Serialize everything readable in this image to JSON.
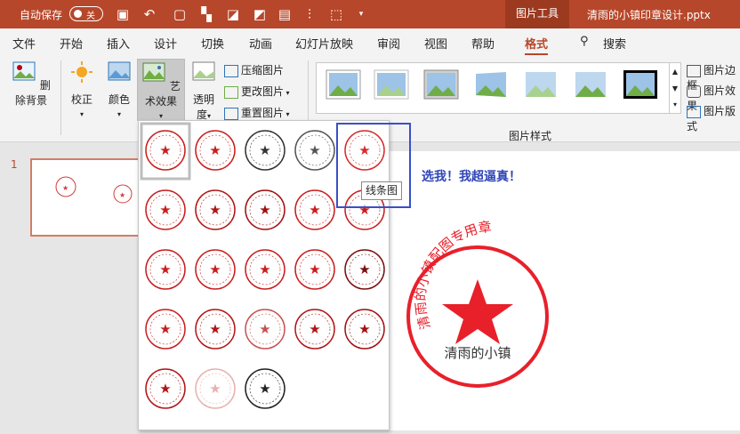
{
  "titlebar": {
    "autosave_label": "自动保存",
    "autosave_toggle": "关",
    "tool_tab": "图片工具",
    "filename": "清雨的小镇印章设计.pptx"
  },
  "menu": [
    "文件",
    "开始",
    "插入",
    "设计",
    "切换",
    "动画",
    "幻灯片放映",
    "审阅",
    "视图",
    "帮助",
    "格式"
  ],
  "search_label": "搜索",
  "ribbon": {
    "remove_bg": "删除背景",
    "correct": "校正",
    "color": "颜色",
    "artistic": "艺术效果",
    "transparency_1": "透明",
    "transparency_2": "度",
    "compress": "压缩图片",
    "change": "更改图片",
    "reset": "重置图片",
    "group_label": "图片样式",
    "border": "图片边框",
    "effects": "图片效果",
    "layout": "图片版式"
  },
  "slide": {
    "number": "1",
    "text": "选我！我超逼真！",
    "stamp_top": "清雨的小镇配图专用章",
    "stamp_bottom": "清雨的小镇"
  },
  "tooltip": "线条图",
  "colors": {
    "accent": "#b7472a",
    "stamp": "#e8202a",
    "hover": "#3a4fc8"
  }
}
